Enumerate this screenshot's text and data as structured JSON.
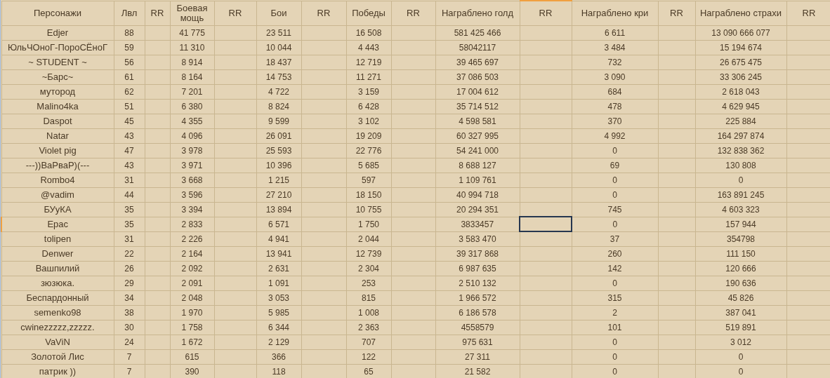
{
  "columns": [
    {
      "label": "Персонажи",
      "kind": "data"
    },
    {
      "label": "Лвл",
      "kind": "data"
    },
    {
      "label": "RR",
      "kind": "rr"
    },
    {
      "label": "Боевая мощь",
      "kind": "data"
    },
    {
      "label": "RR",
      "kind": "rr"
    },
    {
      "label": "Бои",
      "kind": "data"
    },
    {
      "label": "RR",
      "kind": "rr"
    },
    {
      "label": "Победы",
      "kind": "data"
    },
    {
      "label": "RR",
      "kind": "rr"
    },
    {
      "label": "Награблено голд",
      "kind": "data"
    },
    {
      "label": "RR",
      "kind": "rr"
    },
    {
      "label": "Награблено кри",
      "kind": "data"
    },
    {
      "label": "RR",
      "kind": "rr"
    },
    {
      "label": "Награблено страхи",
      "kind": "data"
    },
    {
      "label": "RR",
      "kind": "rr"
    }
  ],
  "rows": [
    {
      "cells": [
        "Edjer",
        "88",
        "41 775",
        "23 511",
        "16 508",
        "581 425 466",
        "6 611",
        "13 090 666 077"
      ],
      "rr_selected": [
        false,
        false,
        false,
        false,
        false,
        false,
        false
      ]
    },
    {
      "cells": [
        "ЮльЧОноГ-ПороСЁноГ",
        "59",
        "11 310",
        "10 044",
        "4 443",
        "58042117",
        "3 484",
        "15 194 674"
      ],
      "rr_selected": [
        false,
        false,
        false,
        false,
        false,
        false,
        false
      ]
    },
    {
      "cells": [
        "~ STUDENT ~",
        "56",
        "8 914",
        "18 437",
        "12 719",
        "39 465 697",
        "732",
        "26 675 475"
      ],
      "rr_selected": [
        false,
        false,
        false,
        false,
        false,
        false,
        false
      ]
    },
    {
      "cells": [
        "~Барс~",
        "61",
        "8 164",
        "14 753",
        "11 271",
        "37 086 503",
        "3 090",
        "33 306 245"
      ],
      "rr_selected": [
        false,
        false,
        false,
        false,
        false,
        false,
        false
      ]
    },
    {
      "cells": [
        "мутород",
        "62",
        "7 201",
        "4 722",
        "3 159",
        "17 004 612",
        "684",
        "2 618 043"
      ],
      "rr_selected": [
        false,
        false,
        false,
        false,
        false,
        false,
        false
      ]
    },
    {
      "cells": [
        "Malino4ka",
        "51",
        "6 380",
        "8 824",
        "6 428",
        "35 714 512",
        "478",
        "4 629 945"
      ],
      "rr_selected": [
        false,
        false,
        false,
        false,
        false,
        false,
        false
      ]
    },
    {
      "cells": [
        "Daspot",
        "45",
        "4 355",
        "9 599",
        "3 102",
        "4 598 581",
        "370",
        "225 884"
      ],
      "rr_selected": [
        false,
        false,
        false,
        false,
        false,
        false,
        false
      ]
    },
    {
      "cells": [
        "Natar",
        "43",
        "4 096",
        "26 091",
        "19 209",
        "60 327 995",
        "4 992",
        "164 297 874"
      ],
      "rr_selected": [
        false,
        false,
        false,
        false,
        false,
        false,
        false
      ]
    },
    {
      "cells": [
        "Violet pig",
        "47",
        "3 978",
        "25 593",
        "22 776",
        "54 241 000",
        "0",
        "132 838 362"
      ],
      "rr_selected": [
        false,
        false,
        false,
        false,
        false,
        false,
        false
      ]
    },
    {
      "cells": [
        "---))ВаРваР)(---",
        "43",
        "3 971",
        "10 396",
        "5 685",
        "8 688 127",
        "69",
        "130 808"
      ],
      "rr_selected": [
        false,
        false,
        false,
        false,
        false,
        false,
        false
      ]
    },
    {
      "cells": [
        "Rombo4",
        "31",
        "3 668",
        "1 215",
        "597",
        "1 109 761",
        "0",
        "0"
      ],
      "rr_selected": [
        false,
        false,
        false,
        false,
        false,
        false,
        false
      ]
    },
    {
      "cells": [
        "@vadim",
        "44",
        "3 596",
        "27 210",
        "18 150",
        "40 994 718",
        "0",
        "163 891 245"
      ],
      "rr_selected": [
        false,
        false,
        false,
        false,
        false,
        false,
        false
      ]
    },
    {
      "cells": [
        "БУуКА",
        "35",
        "3 394",
        "13 894",
        "10 755",
        "20 294 351",
        "745",
        "4 603 323"
      ],
      "rr_selected": [
        false,
        false,
        false,
        false,
        false,
        false,
        false
      ]
    },
    {
      "cells": [
        "Epac",
        "35",
        "2 833",
        "6 571",
        "1 750",
        "3833457",
        "0",
        "157 944"
      ],
      "rr_selected": [
        false,
        false,
        false,
        false,
        true,
        false,
        false
      ]
    },
    {
      "cells": [
        "tolipen",
        "31",
        "2 226",
        "4 941",
        "2 044",
        "3 583 470",
        "37",
        "354798"
      ],
      "rr_selected": [
        false,
        false,
        false,
        false,
        false,
        false,
        false
      ]
    },
    {
      "cells": [
        "Denwer",
        "22",
        "2 164",
        "13 941",
        "12 739",
        "39 317 868",
        "260",
        "111 150"
      ],
      "rr_selected": [
        false,
        false,
        false,
        false,
        false,
        false,
        false
      ]
    },
    {
      "cells": [
        "Вашпилий",
        "26",
        "2 092",
        "2 631",
        "2 304",
        "6 987 635",
        "142",
        "120 666"
      ],
      "rr_selected": [
        false,
        false,
        false,
        false,
        false,
        false,
        false
      ]
    },
    {
      "cells": [
        "зюзюка.",
        "29",
        "2 091",
        "1 091",
        "253",
        "2 510 132",
        "0",
        "190 636"
      ],
      "rr_selected": [
        false,
        false,
        false,
        false,
        false,
        false,
        false
      ]
    },
    {
      "cells": [
        "Беспардонный",
        "34",
        "2 048",
        "3 053",
        "815",
        "1 966 572",
        "315",
        "45 826"
      ],
      "rr_selected": [
        false,
        false,
        false,
        false,
        false,
        false,
        false
      ]
    },
    {
      "cells": [
        "semenko98",
        "38",
        "1 970",
        "5 985",
        "1 008",
        "6 186 578",
        "2",
        "387 041"
      ],
      "rr_selected": [
        false,
        false,
        false,
        false,
        false,
        false,
        false
      ]
    },
    {
      "cells": [
        "cwinezzzzz,zzzzz.",
        "30",
        "1 758",
        "6 344",
        "2 363",
        "4558579",
        "101",
        "519 891"
      ],
      "rr_selected": [
        false,
        false,
        false,
        false,
        false,
        false,
        false
      ]
    },
    {
      "cells": [
        "VaViN",
        "24",
        "1 672",
        "2 129",
        "707",
        "975 631",
        "0",
        "3 012"
      ],
      "rr_selected": [
        false,
        false,
        false,
        false,
        false,
        false,
        false
      ]
    },
    {
      "cells": [
        "Золотой Лис",
        "7",
        "615",
        "366",
        "122",
        "27 311",
        "0",
        "0"
      ],
      "rr_selected": [
        false,
        false,
        false,
        false,
        false,
        false,
        false
      ]
    },
    {
      "cells": [
        "патрик ))",
        "7",
        "390",
        "118",
        "65",
        "21 582",
        "0",
        "0"
      ],
      "rr_selected": [
        false,
        false,
        false,
        false,
        false,
        false,
        false
      ]
    }
  ]
}
